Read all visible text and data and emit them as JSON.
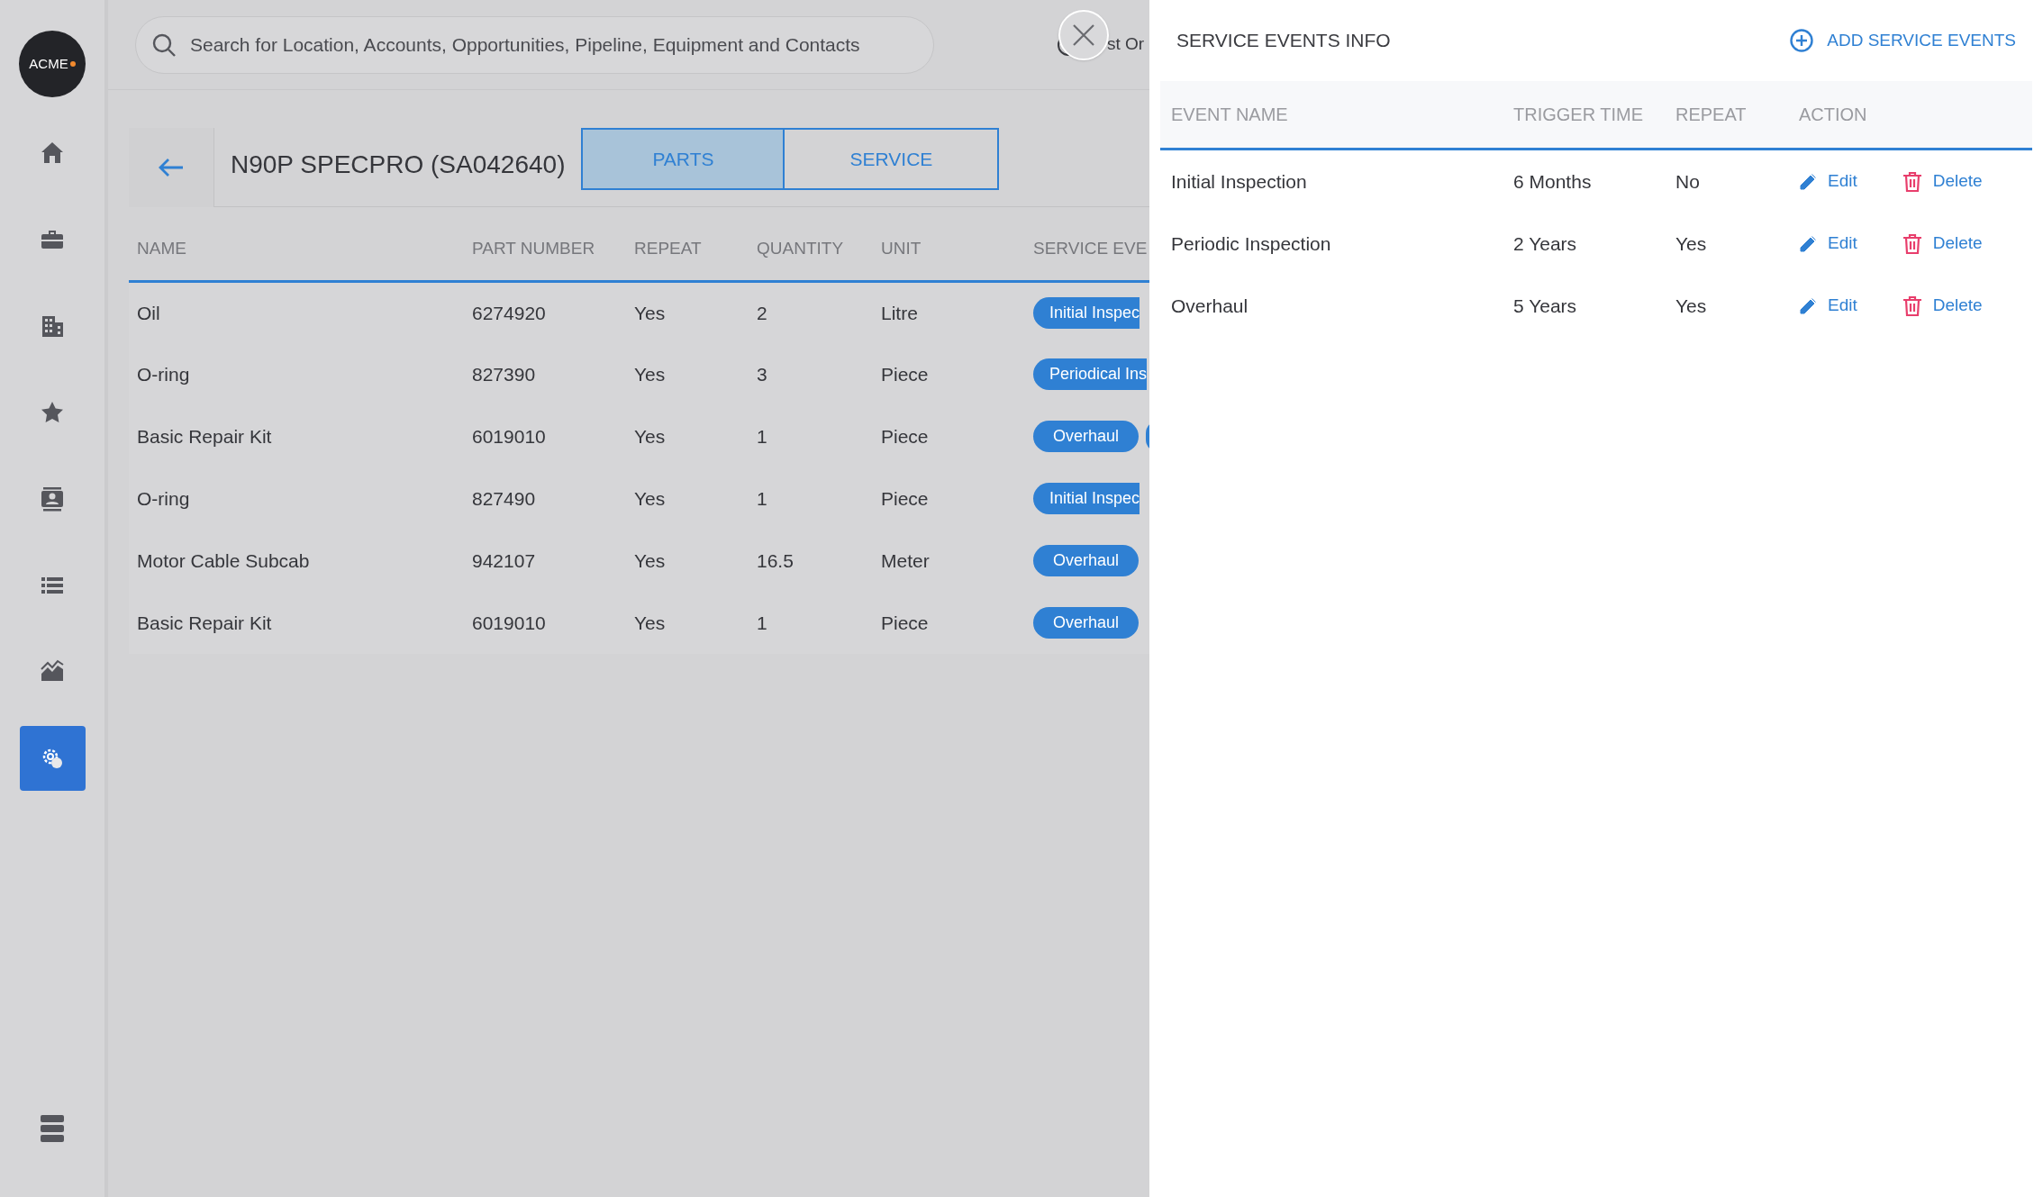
{
  "sidebar": {
    "logo": "ACME",
    "items": [
      {
        "kind": "home",
        "selected": false
      },
      {
        "kind": "briefcase",
        "selected": false
      },
      {
        "kind": "building",
        "selected": false
      },
      {
        "kind": "star",
        "selected": false
      },
      {
        "kind": "contact",
        "selected": false
      },
      {
        "kind": "list",
        "selected": false
      },
      {
        "kind": "chart",
        "selected": false
      },
      {
        "kind": "gear",
        "selected": true
      }
    ]
  },
  "search": {
    "placeholder": "Search for Location, Accounts, Opportunities, Pipeline, Equipment and Contacts"
  },
  "header_link": "st Or",
  "equipment": {
    "title": "N90P SPECPRO (SA042640)",
    "tabs": [
      {
        "label": "PARTS",
        "selected": true
      },
      {
        "label": "SERVICE",
        "selected": false
      }
    ]
  },
  "parts_table": {
    "columns": [
      "NAME",
      "PART NUMBER",
      "REPEAT",
      "QUANTITY",
      "UNIT",
      "SERVICE EVE"
    ],
    "rows": [
      {
        "cells": [
          "Oil",
          "6274920",
          "Yes",
          "2",
          "Litre"
        ],
        "events": [
          {
            "label": "Initial Inspec",
            "cut": true
          }
        ]
      },
      {
        "cells": [
          "O-ring",
          "827390",
          "Yes",
          "3",
          "Piece"
        ],
        "events": [
          {
            "label": "Periodical Ins",
            "cut": true
          }
        ]
      },
      {
        "cells": [
          "Basic Repair Kit",
          "6019010",
          "Yes",
          "1",
          "Piece"
        ],
        "events": [
          {
            "label": "Overhaul",
            "cut": false
          }
        ],
        "more": true
      },
      {
        "cells": [
          "O-ring",
          "827490",
          "Yes",
          "1",
          "Piece"
        ],
        "events": [
          {
            "label": "Initial Inspec",
            "cut": true
          }
        ]
      },
      {
        "cells": [
          "Motor Cable Subcab",
          "942107",
          "Yes",
          "16.5",
          "Meter"
        ],
        "events": [
          {
            "label": "Overhaul",
            "cut": false
          }
        ]
      },
      {
        "cells": [
          "Basic Repair Kit",
          "6019010",
          "Yes",
          "1",
          "Piece"
        ],
        "events": [
          {
            "label": "Overhaul",
            "cut": false
          }
        ]
      }
    ]
  },
  "panel": {
    "title": "SERVICE EVENTS INFO",
    "add_button": "ADD SERVICE EVENTS",
    "columns": [
      "EVENT NAME",
      "TRIGGER TIME",
      "REPEAT",
      "ACTION"
    ],
    "rows": [
      {
        "name": "Initial Inspection",
        "trigger": "6 Months",
        "repeat": "No",
        "edit": "Edit",
        "delete": "Delete"
      },
      {
        "name": "Periodic Inspection",
        "trigger": "2 Years",
        "repeat": "Yes",
        "edit": "Edit",
        "delete": "Delete"
      },
      {
        "name": "Overhaul",
        "trigger": "5 Years",
        "repeat": "Yes",
        "edit": "Edit",
        "delete": "Delete"
      }
    ]
  }
}
